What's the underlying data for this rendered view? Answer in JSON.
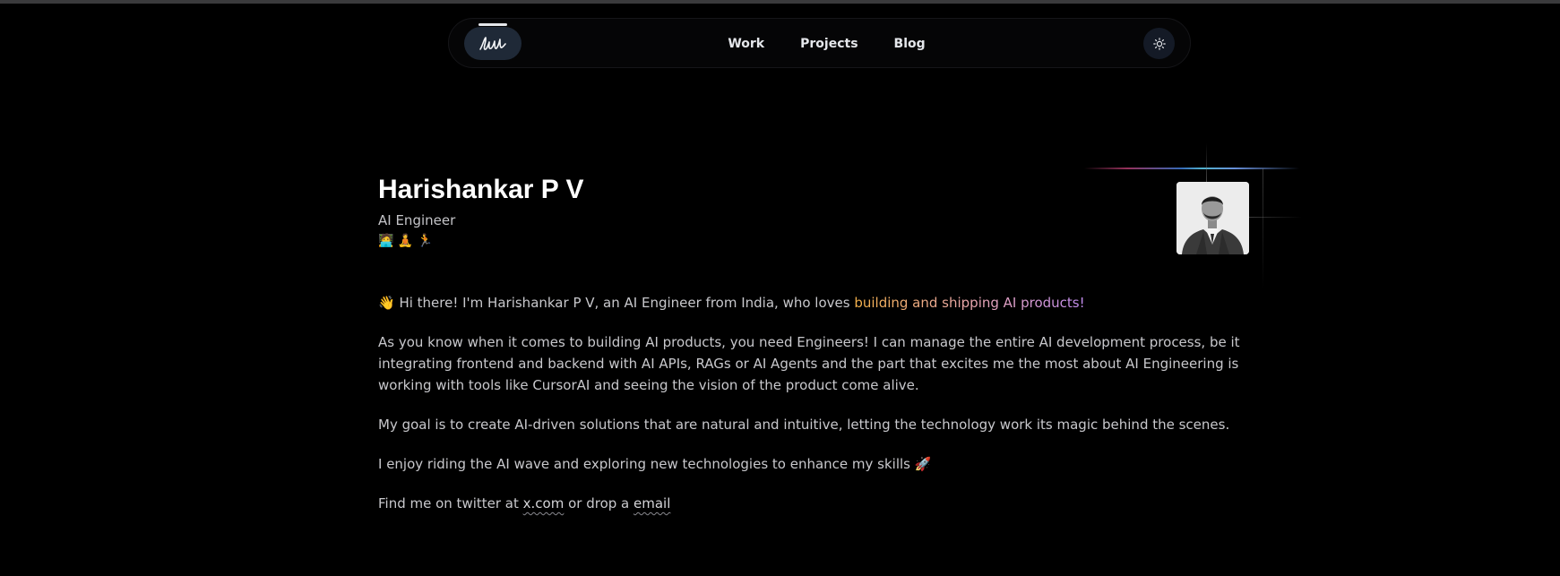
{
  "nav": {
    "links": [
      {
        "label": "Work"
      },
      {
        "label": "Projects"
      },
      {
        "label": "Blog"
      }
    ],
    "logo_icon": "signature-logo-icon",
    "theme_icon": "sun-icon"
  },
  "profile": {
    "name": "Harishankar P V",
    "role": "AI Engineer",
    "emojis": "🧑‍💻 🧘 🏃"
  },
  "intro": {
    "wave": "👋",
    "prefix": " Hi there! I'm Harishankar P V, an AI Engineer from India, who loves ",
    "highlight": "building and shipping AI products!"
  },
  "paragraphs": {
    "p1": "As you know when it comes to building AI products, you need Engineers! I can manage the entire AI development process, be it integrating frontend and backend with AI APIs, RAGs or AI Agents and the part that excites me the most about AI Engineering is working with tools like CursorAI and seeing the vision of the product come alive.",
    "p2": "My goal is to create AI-driven solutions that are natural and intuitive, letting the technology work its magic behind the scenes.",
    "p3": "I enjoy riding the AI wave and exploring new technologies to enhance my skills 🚀"
  },
  "contact": {
    "prefix": "Find me on twitter at ",
    "twitter_link": "x.com",
    "middle": " or drop a ",
    "email_link": "email"
  },
  "colors": {
    "background": "#000000",
    "highlight_gradient_start": "#f5b24a",
    "highlight_gradient_end": "#c28cf0"
  }
}
